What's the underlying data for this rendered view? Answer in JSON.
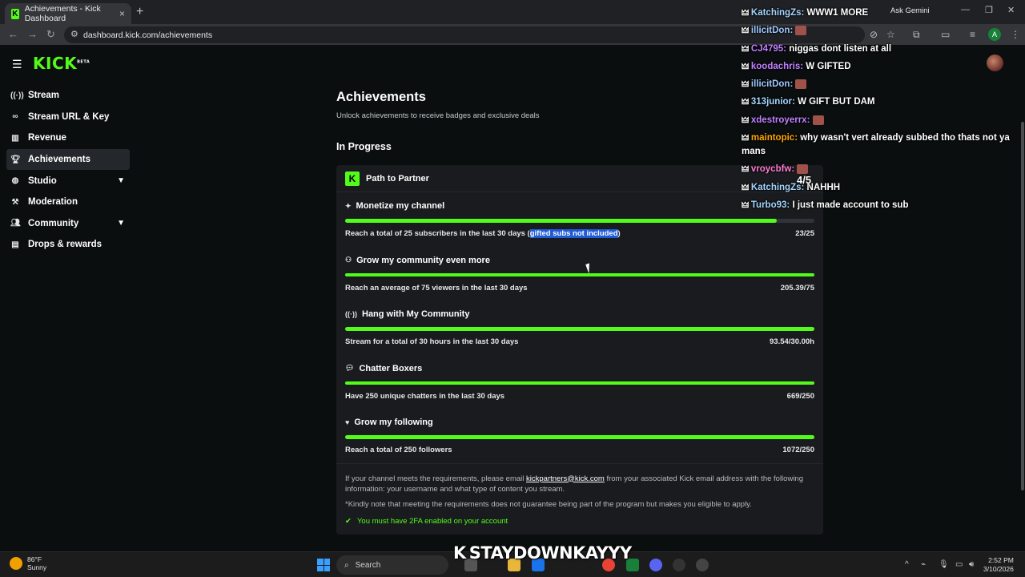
{
  "browser": {
    "tab_title": "Achievements - Kick Dashboard",
    "tab_close": "×",
    "new_tab": "+",
    "url": "dashboard.kick.com/achievements",
    "ask_gemini": "Ask Gemini",
    "profile_initial": "A"
  },
  "header": {
    "logo_text": "KICK",
    "logo_badge": "BETA"
  },
  "sidebar": {
    "items": [
      {
        "label": "Stream",
        "icon": "broadcast-icon"
      },
      {
        "label": "Stream URL & Key",
        "icon": "link-icon"
      },
      {
        "label": "Revenue",
        "icon": "chart-icon"
      },
      {
        "label": "Achievements",
        "icon": "trophy-icon"
      },
      {
        "label": "Studio",
        "icon": "globe-icon"
      },
      {
        "label": "Moderation",
        "icon": "hammer-icon"
      },
      {
        "label": "Community",
        "icon": "users-icon"
      },
      {
        "label": "Drops & rewards",
        "icon": "gift-icon"
      }
    ]
  },
  "main": {
    "title": "Achievements",
    "subtitle": "Unlock achievements to receive badges and exclusive deals",
    "section": "In Progress",
    "card_title": "Path to Partner",
    "achievements": [
      {
        "title": "Monetize my channel",
        "desc": "Reach a total of 25 subscribers in the last 30 days (",
        "desc_hl": "gifted subs not included",
        "desc_end": ")",
        "value": "23/25",
        "progress": 0.92
      },
      {
        "title": "Grow my community even more",
        "desc": "Reach an average of 75 viewers in the last 30 days",
        "desc_hl": "",
        "desc_end": "",
        "value": "205.39/75",
        "progress": 1.0
      },
      {
        "title": "Hang with My Community",
        "desc": "Stream for a total of 30 hours in the last 30 days",
        "desc_hl": "",
        "desc_end": "",
        "value": "93.54/30.00h",
        "progress": 1.0
      },
      {
        "title": "Chatter Boxers",
        "desc": "Have 250 unique chatters in the last 30 days",
        "desc_hl": "",
        "desc_end": "",
        "value": "669/250",
        "progress": 1.0
      },
      {
        "title": "Grow my following",
        "desc": "Reach a total of 250 followers",
        "desc_hl": "",
        "desc_end": "",
        "value": "1072/250",
        "progress": 1.0
      }
    ],
    "footer_text_1": "If your channel meets the requirements, please email ",
    "footer_email": "kickpartners@kick.com",
    "footer_text_2": " from your associated Kick email address with the following information: your username and what type of content you stream.",
    "footer_note": "*Kindly note that meeting the requirements does not guarantee being part of the program but makes you eligible to apply.",
    "footer_check": "You must have 2FA enabled on your account"
  },
  "chat": {
    "messages": [
      {
        "user": "KatchingZs:",
        "text": "WWW1 MORE",
        "color": "u-sky"
      },
      {
        "user": "illicitDon:",
        "text": "",
        "color": "u-blue",
        "emote": true
      },
      {
        "user": "CJ4795:",
        "text": "niggas dont listen at all",
        "color": "u-purple"
      },
      {
        "user": "koodachris:",
        "text": "W GIFTED",
        "color": "u-purple"
      },
      {
        "user": "illicitDon:",
        "text": "",
        "color": "u-blue",
        "emote": true
      },
      {
        "user": "313junior:",
        "text": "W GIFT BUT DAM",
        "color": "u-sky"
      },
      {
        "user": "xdestroyerrx:",
        "text": "",
        "color": "u-purple",
        "emote": true
      },
      {
        "user": "maintopic:",
        "text": "why wasn't vert already subbed tho thats not ya mans",
        "color": "u-gold"
      },
      {
        "user": "vroycbfw:",
        "text": "",
        "color": "u-pink",
        "emote": true
      },
      {
        "user": "KatchingZs:",
        "text": "NAHHH",
        "color": "u-sky"
      },
      {
        "user": "Turbo93:",
        "text": "I just made account to sub",
        "color": "u-sky"
      }
    ],
    "counter": "4/5"
  },
  "taskbar": {
    "temp": "86°F",
    "condition": "Sunny",
    "search": "Search",
    "time": "2:52 PM",
    "date": "3/10/2026",
    "overlay_name": "STAYDOWNKAYYY",
    "overlay_k": "K"
  },
  "colors": {
    "accent": "#53fc18",
    "bg": "#0b0e0f",
    "card": "#191b1f"
  }
}
